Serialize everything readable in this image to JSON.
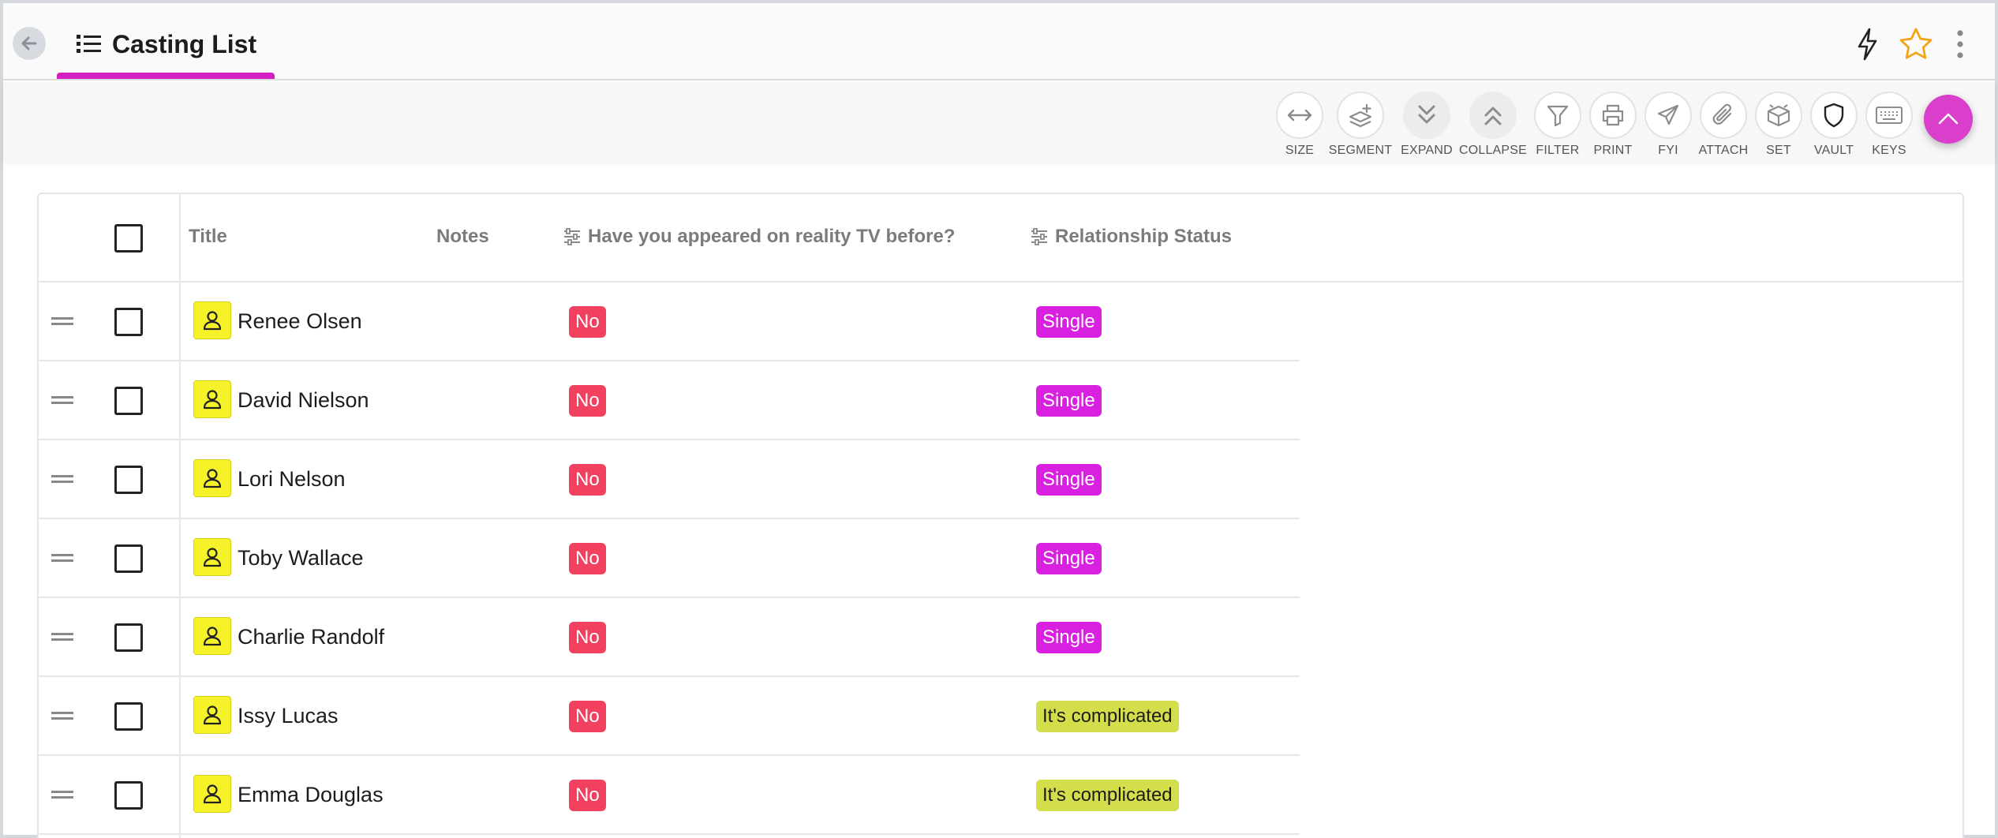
{
  "header": {
    "title": "Casting List",
    "icons": [
      "back-arrow-icon",
      "list-icon",
      "lightning-icon",
      "star-icon",
      "more-vertical-icon"
    ],
    "accent": "#d41ec0",
    "star_color": "#f2a414"
  },
  "toolbar": {
    "tools": [
      {
        "label": "SIZE",
        "icon": "resize-horizontal-icon"
      },
      {
        "label": "SEGMENT",
        "icon": "segment-add-icon"
      },
      {
        "label": "EXPAND",
        "icon": "chevrons-down-icon"
      },
      {
        "label": "COLLAPSE",
        "icon": "chevrons-up-icon"
      },
      {
        "label": "FILTER",
        "icon": "filter-icon"
      },
      {
        "label": "PRINT",
        "icon": "printer-icon"
      },
      {
        "label": "FYI",
        "icon": "send-icon"
      },
      {
        "label": "ATTACH",
        "icon": "paperclip-icon"
      },
      {
        "label": "SET",
        "icon": "box-icon"
      },
      {
        "label": "VAULT",
        "icon": "shield-icon"
      },
      {
        "label": "KEYS",
        "icon": "keyboard-icon"
      }
    ],
    "fab_icon": "chevron-up-icon",
    "fab_color": "#d93fcb"
  },
  "table": {
    "columns": {
      "title": "Title",
      "notes": "Notes",
      "reality_tv": "Have you appeared on reality TV before?",
      "relationship": "Relationship Status"
    },
    "rows": [
      {
        "name": "Renee Olsen",
        "notes": "",
        "reality_tv": "No",
        "relationship": "Single"
      },
      {
        "name": "David Nielson",
        "notes": "",
        "reality_tv": "No",
        "relationship": "Single"
      },
      {
        "name": "Lori Nelson",
        "notes": "",
        "reality_tv": "No",
        "relationship": "Single"
      },
      {
        "name": "Toby Wallace",
        "notes": "",
        "reality_tv": "No",
        "relationship": "Single"
      },
      {
        "name": "Charlie Randolf",
        "notes": "",
        "reality_tv": "No",
        "relationship": "Single"
      },
      {
        "name": "Issy Lucas",
        "notes": "",
        "reality_tv": "No",
        "relationship": "It's complicated"
      },
      {
        "name": "Emma Douglas",
        "notes": "",
        "reality_tv": "No",
        "relationship": "It's complicated"
      }
    ],
    "colors": {
      "no": "#f2405f",
      "single": "#d91fe0",
      "complicated": "#d4dd4a",
      "avatar": "#f6f22a"
    }
  }
}
